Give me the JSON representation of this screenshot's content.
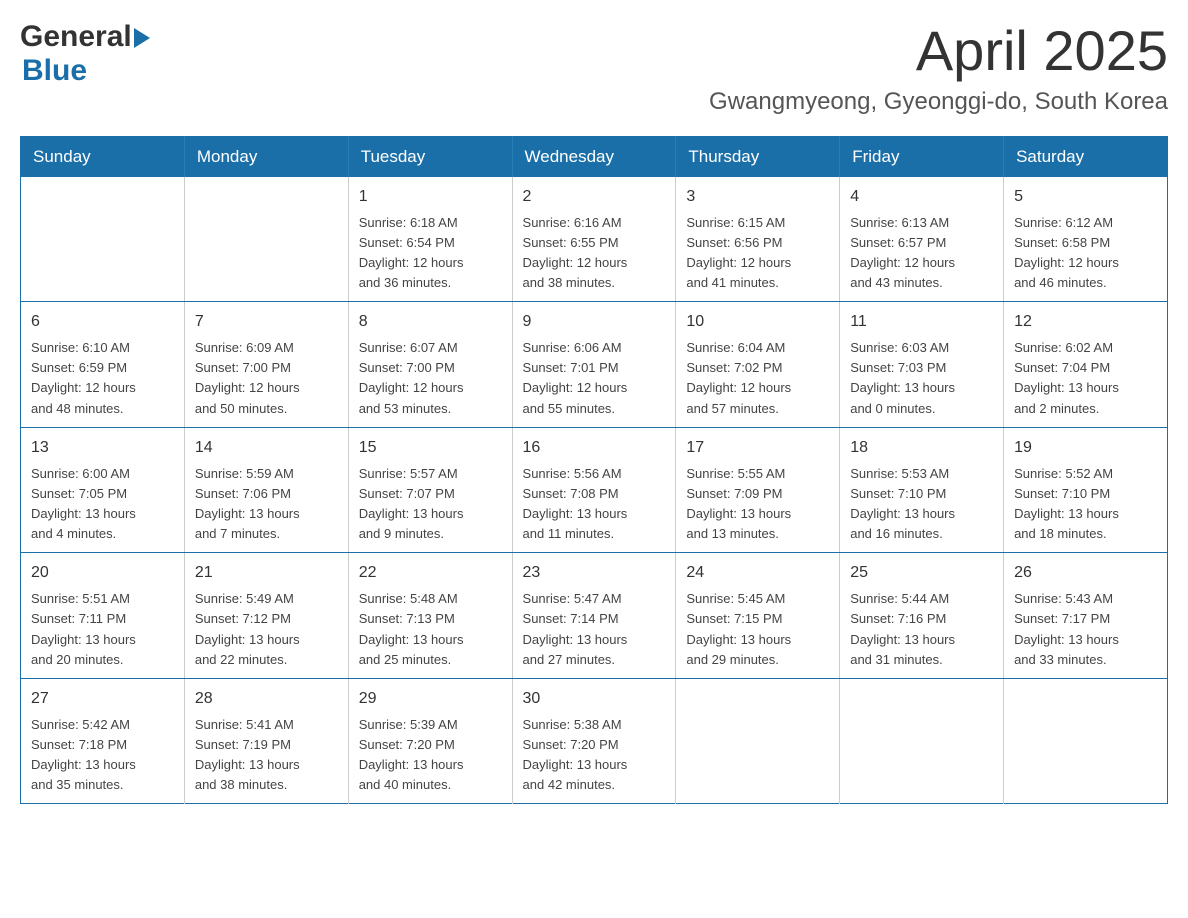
{
  "logo": {
    "general": "General",
    "blue": "Blue"
  },
  "title": {
    "month_year": "April 2025",
    "location": "Gwangmyeong, Gyeonggi-do, South Korea"
  },
  "weekdays": [
    "Sunday",
    "Monday",
    "Tuesday",
    "Wednesday",
    "Thursday",
    "Friday",
    "Saturday"
  ],
  "weeks": [
    [
      {
        "day": "",
        "info": ""
      },
      {
        "day": "",
        "info": ""
      },
      {
        "day": "1",
        "info": "Sunrise: 6:18 AM\nSunset: 6:54 PM\nDaylight: 12 hours\nand 36 minutes."
      },
      {
        "day": "2",
        "info": "Sunrise: 6:16 AM\nSunset: 6:55 PM\nDaylight: 12 hours\nand 38 minutes."
      },
      {
        "day": "3",
        "info": "Sunrise: 6:15 AM\nSunset: 6:56 PM\nDaylight: 12 hours\nand 41 minutes."
      },
      {
        "day": "4",
        "info": "Sunrise: 6:13 AM\nSunset: 6:57 PM\nDaylight: 12 hours\nand 43 minutes."
      },
      {
        "day": "5",
        "info": "Sunrise: 6:12 AM\nSunset: 6:58 PM\nDaylight: 12 hours\nand 46 minutes."
      }
    ],
    [
      {
        "day": "6",
        "info": "Sunrise: 6:10 AM\nSunset: 6:59 PM\nDaylight: 12 hours\nand 48 minutes."
      },
      {
        "day": "7",
        "info": "Sunrise: 6:09 AM\nSunset: 7:00 PM\nDaylight: 12 hours\nand 50 minutes."
      },
      {
        "day": "8",
        "info": "Sunrise: 6:07 AM\nSunset: 7:00 PM\nDaylight: 12 hours\nand 53 minutes."
      },
      {
        "day": "9",
        "info": "Sunrise: 6:06 AM\nSunset: 7:01 PM\nDaylight: 12 hours\nand 55 minutes."
      },
      {
        "day": "10",
        "info": "Sunrise: 6:04 AM\nSunset: 7:02 PM\nDaylight: 12 hours\nand 57 minutes."
      },
      {
        "day": "11",
        "info": "Sunrise: 6:03 AM\nSunset: 7:03 PM\nDaylight: 13 hours\nand 0 minutes."
      },
      {
        "day": "12",
        "info": "Sunrise: 6:02 AM\nSunset: 7:04 PM\nDaylight: 13 hours\nand 2 minutes."
      }
    ],
    [
      {
        "day": "13",
        "info": "Sunrise: 6:00 AM\nSunset: 7:05 PM\nDaylight: 13 hours\nand 4 minutes."
      },
      {
        "day": "14",
        "info": "Sunrise: 5:59 AM\nSunset: 7:06 PM\nDaylight: 13 hours\nand 7 minutes."
      },
      {
        "day": "15",
        "info": "Sunrise: 5:57 AM\nSunset: 7:07 PM\nDaylight: 13 hours\nand 9 minutes."
      },
      {
        "day": "16",
        "info": "Sunrise: 5:56 AM\nSunset: 7:08 PM\nDaylight: 13 hours\nand 11 minutes."
      },
      {
        "day": "17",
        "info": "Sunrise: 5:55 AM\nSunset: 7:09 PM\nDaylight: 13 hours\nand 13 minutes."
      },
      {
        "day": "18",
        "info": "Sunrise: 5:53 AM\nSunset: 7:10 PM\nDaylight: 13 hours\nand 16 minutes."
      },
      {
        "day": "19",
        "info": "Sunrise: 5:52 AM\nSunset: 7:10 PM\nDaylight: 13 hours\nand 18 minutes."
      }
    ],
    [
      {
        "day": "20",
        "info": "Sunrise: 5:51 AM\nSunset: 7:11 PM\nDaylight: 13 hours\nand 20 minutes."
      },
      {
        "day": "21",
        "info": "Sunrise: 5:49 AM\nSunset: 7:12 PM\nDaylight: 13 hours\nand 22 minutes."
      },
      {
        "day": "22",
        "info": "Sunrise: 5:48 AM\nSunset: 7:13 PM\nDaylight: 13 hours\nand 25 minutes."
      },
      {
        "day": "23",
        "info": "Sunrise: 5:47 AM\nSunset: 7:14 PM\nDaylight: 13 hours\nand 27 minutes."
      },
      {
        "day": "24",
        "info": "Sunrise: 5:45 AM\nSunset: 7:15 PM\nDaylight: 13 hours\nand 29 minutes."
      },
      {
        "day": "25",
        "info": "Sunrise: 5:44 AM\nSunset: 7:16 PM\nDaylight: 13 hours\nand 31 minutes."
      },
      {
        "day": "26",
        "info": "Sunrise: 5:43 AM\nSunset: 7:17 PM\nDaylight: 13 hours\nand 33 minutes."
      }
    ],
    [
      {
        "day": "27",
        "info": "Sunrise: 5:42 AM\nSunset: 7:18 PM\nDaylight: 13 hours\nand 35 minutes."
      },
      {
        "day": "28",
        "info": "Sunrise: 5:41 AM\nSunset: 7:19 PM\nDaylight: 13 hours\nand 38 minutes."
      },
      {
        "day": "29",
        "info": "Sunrise: 5:39 AM\nSunset: 7:20 PM\nDaylight: 13 hours\nand 40 minutes."
      },
      {
        "day": "30",
        "info": "Sunrise: 5:38 AM\nSunset: 7:20 PM\nDaylight: 13 hours\nand 42 minutes."
      },
      {
        "day": "",
        "info": ""
      },
      {
        "day": "",
        "info": ""
      },
      {
        "day": "",
        "info": ""
      }
    ]
  ]
}
